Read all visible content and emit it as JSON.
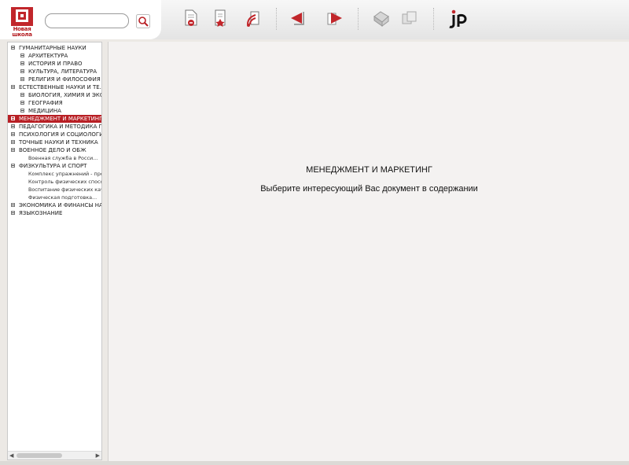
{
  "logo": {
    "text": "Новая школа"
  },
  "search": {
    "value": "",
    "placeholder": ""
  },
  "toolbar": {
    "icons": [
      "document-print-icon",
      "document-bookmark-icon",
      "document-tree-icon",
      "back-arrow-icon",
      "forward-arrow-icon",
      "printer-icon",
      "copy-icon",
      "publisher-logo-icon"
    ]
  },
  "tree": {
    "items": [
      {
        "label": "ГУМАНИТАРНЫЕ НАУКИ"
      },
      {
        "label": "АРХИТЕКТУРА"
      },
      {
        "label": "ИСТОРИЯ И ПРАВО"
      },
      {
        "label": "КУЛЬТУРА, ЛИТЕРАТУРА"
      },
      {
        "label": "РЕЛИГИЯ И ФИЛОСОФИЯ"
      },
      {
        "label": "ЕСТЕСТВЕННЫЕ НАУКИ И ТЕ..."
      },
      {
        "label": "БИОЛОГИЯ, ХИМИЯ И ЭКО..."
      },
      {
        "label": "ГЕОГРАФИЯ"
      },
      {
        "label": "МЕДИЦИНА"
      },
      {
        "label": "МЕНЕДЖМЕНТ И МАРКЕТИНГ"
      },
      {
        "label": "ПЕДАГОГИКА И МЕТОДИКА П..."
      },
      {
        "label": "ПСИХОЛОГИЯ И СОЦИОЛОГИЯ"
      },
      {
        "label": "ТОЧНЫЕ НАУКИ И ТЕХНИКА"
      },
      {
        "label": "ВОЕННОЕ ДЕЛО И ОБЖ"
      },
      {
        "label": "Военная служба в Росси..."
      },
      {
        "label": "ФИЗКУЛЬТУРА И СПОРТ"
      },
      {
        "label": "Комплекс упражнений - проф..."
      },
      {
        "label": "Контроль физических спосо..."
      },
      {
        "label": "Воспитание физических каче..."
      },
      {
        "label": "Физическая подготовка..."
      },
      {
        "label": "ЭКОНОМИКА И ФИНАНСЫ НА..."
      },
      {
        "label": "ЯЗЫКОЗНАНИЕ"
      }
    ]
  },
  "content": {
    "title": "МЕНЕДЖМЕНТ И МАРКЕТИНГ",
    "subtitle": "Выберите интересующий Вас документ в содержании"
  },
  "colors": {
    "accent": "#b81f24",
    "panel_bg": "#f4f2f1",
    "toolbar_bg": "#e8e8e8"
  }
}
